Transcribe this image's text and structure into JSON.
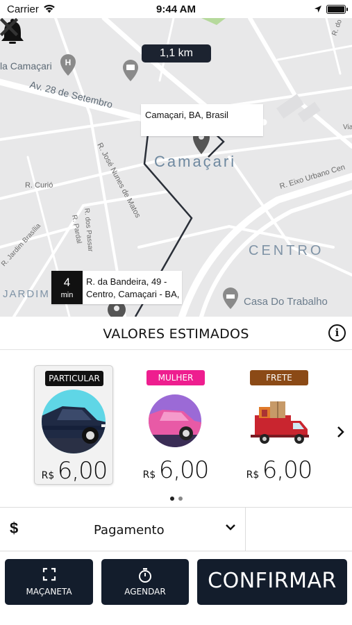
{
  "status_bar": {
    "carrier": "Carrier",
    "time": "9:44 AM"
  },
  "map": {
    "distance": "1,1 km",
    "origin_callout": "Camaçari, BA, Brasil",
    "eta_value": "4",
    "eta_unit": "min",
    "pickup_line1": "R. da Bandeira, 49 -",
    "pickup_line2": "Centro, Camaçari - BA,",
    "labels": {
      "city": "Camaçari",
      "centro": "CENTRO",
      "jardim": "JARDIM BRASILIA",
      "casa": "Casa Do Trabalho",
      "av28": "Av. 28 de Setembro",
      "eixo": "R. Eixo Urbano Cen",
      "curio": "R. Curió",
      "jose": "R. José Nunes de Matos",
      "passaro": "R. dos Passar",
      "pardal": "R. Pardal",
      "jbrasilia": "R. Jardim Brasília",
      "lacamacari": "la Camaçari",
      "via": "Via",
      "rdo": "R. do"
    },
    "icons": {
      "notification": "bell-icon",
      "close": "close-icon"
    }
  },
  "estimates": {
    "title": "VALORES ESTIMADOS",
    "options": [
      {
        "category": "PARTICULAR",
        "currency": "R$",
        "price": "6,00",
        "badge_color": "#111111",
        "selected": true
      },
      {
        "category": "MULHER",
        "currency": "R$",
        "price": "6,00",
        "badge_color": "#ee1e8f",
        "selected": false
      },
      {
        "category": "FRETE",
        "currency": "R$",
        "price": "6,00",
        "badge_color": "#8b4a16",
        "selected": false
      }
    ]
  },
  "payment": {
    "icon": "$",
    "label": "Pagamento"
  },
  "actions": {
    "handle": "MAÇANETA",
    "schedule": "AGENDAR",
    "confirm": "CONFIRMAR"
  },
  "colors": {
    "dark_button": "#131d2c",
    "map_bg": "#e9e9ea"
  }
}
